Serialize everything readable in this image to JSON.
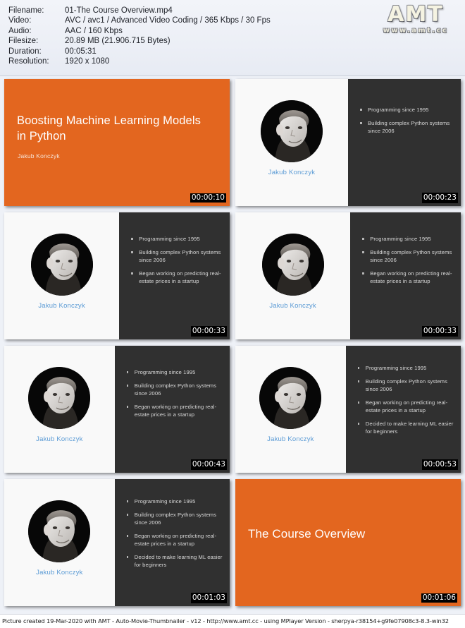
{
  "header": {
    "fields": [
      {
        "label": "Filename:",
        "value": "01-The Course Overview.mp4"
      },
      {
        "label": "Video:",
        "value": "AVC / avc1 / Advanced Video Coding / 365 Kbps / 30 Fps"
      },
      {
        "label": "Audio:",
        "value": "AAC / 160 Kbps"
      },
      {
        "label": "Filesize:",
        "value": "20.89 MB (21.906.715 Bytes)"
      },
      {
        "label": "Duration:",
        "value": "00:05:31"
      },
      {
        "label": "Resolution:",
        "value": "1920 x 1080"
      }
    ],
    "logo": {
      "name": "AMT",
      "url": "www.amt.cc"
    }
  },
  "colors": {
    "orange": "#e3661f",
    "dark_panel": "#303030",
    "light_panel": "#f9f9f9",
    "name_blue": "#5b9bd5",
    "page_background": "#eef1f7"
  },
  "speaker": {
    "name": "Jakub Konczyk"
  },
  "bullet_texts": {
    "b1": "Programming since 1995",
    "b2": "Building complex Python systems since 2006",
    "b3": "Began working on predicting real-estate prices in a startup",
    "b4": "Decided to make learning ML easier for beginners"
  },
  "thumbnails": [
    {
      "type": "title",
      "timestamp": "00:00:10",
      "title": "Boosting Machine Learning Models in Python",
      "subtitle": "Jakub Konczyk"
    },
    {
      "type": "split",
      "timestamp": "00:00:23",
      "name": "Jakub Konczyk",
      "split_left_pct": 50,
      "bullets": [
        "Programming since 1995",
        "Building complex Python systems since 2006"
      ]
    },
    {
      "type": "split",
      "timestamp": "00:00:33",
      "name": "Jakub Konczyk",
      "split_left_pct": 51,
      "bullets": [
        "Programming since 1995",
        "Building complex Python systems since 2006",
        "Began working on predicting real-estate prices in a startup"
      ]
    },
    {
      "type": "split",
      "timestamp": "00:00:33",
      "name": "Jakub Konczyk",
      "split_left_pct": 51,
      "bullets": [
        "Programming since 1995",
        "Building complex Python systems since 2006",
        "Began working on predicting real-estate prices in a startup"
      ]
    },
    {
      "type": "split",
      "timestamp": "00:00:43",
      "name": "Jakub Konczyk",
      "split_left_pct": 49,
      "bullets": [
        "Programming since 1995",
        "Building complex Python systems since 2006",
        "Began working on predicting real-estate prices in a startup"
      ]
    },
    {
      "type": "split",
      "timestamp": "00:00:53",
      "name": "Jakub Konczyk",
      "split_left_pct": 49,
      "bullets": [
        "Programming since 1995",
        "Building complex Python systems since 2006",
        "Began working on predicting real-estate prices in a startup",
        "Decided to make learning ML easier for beginners"
      ]
    },
    {
      "type": "split",
      "timestamp": "00:01:03",
      "name": "Jakub Konczyk",
      "split_left_pct": 49,
      "bullets": [
        "Programming since 1995",
        "Building complex Python systems since 2006",
        "Began working on predicting real-estate prices in a startup",
        "Decided to make learning ML easier for beginners"
      ]
    },
    {
      "type": "section",
      "timestamp": "00:01:06",
      "title": "The Course Overview"
    }
  ],
  "footer": {
    "text": "Picture created 19-Mar-2020 with AMT - Auto-Movie-Thumbnailer - v12 - http://www.amt.cc - using MPlayer Version - sherpya-r38154+g9fe07908c3-8.3-win32"
  }
}
